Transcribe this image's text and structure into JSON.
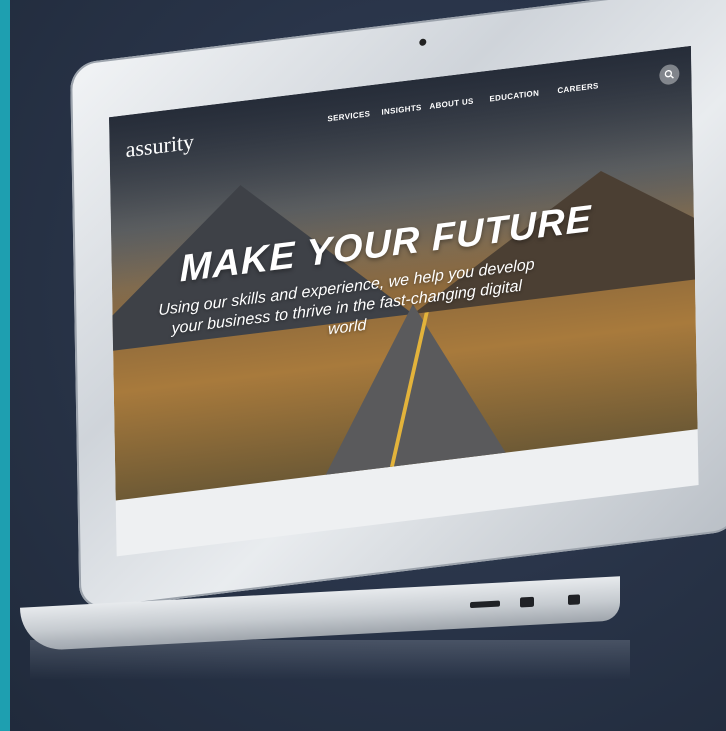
{
  "site": {
    "logo": "assurity",
    "nav": [
      "SERVICES",
      "INSIGHTS",
      "ABOUT US",
      "EDUCATION",
      "CAREERS"
    ],
    "search_icon": "search-icon",
    "headline": "MAKE YOUR FUTURE",
    "subline": "Using our skills and experience, we help you develop your business to thrive in the fast-changing digital world"
  },
  "colors": {
    "accent_bar": "#1e9fb0",
    "background": "#283347",
    "road_line": "#e3b33b"
  }
}
